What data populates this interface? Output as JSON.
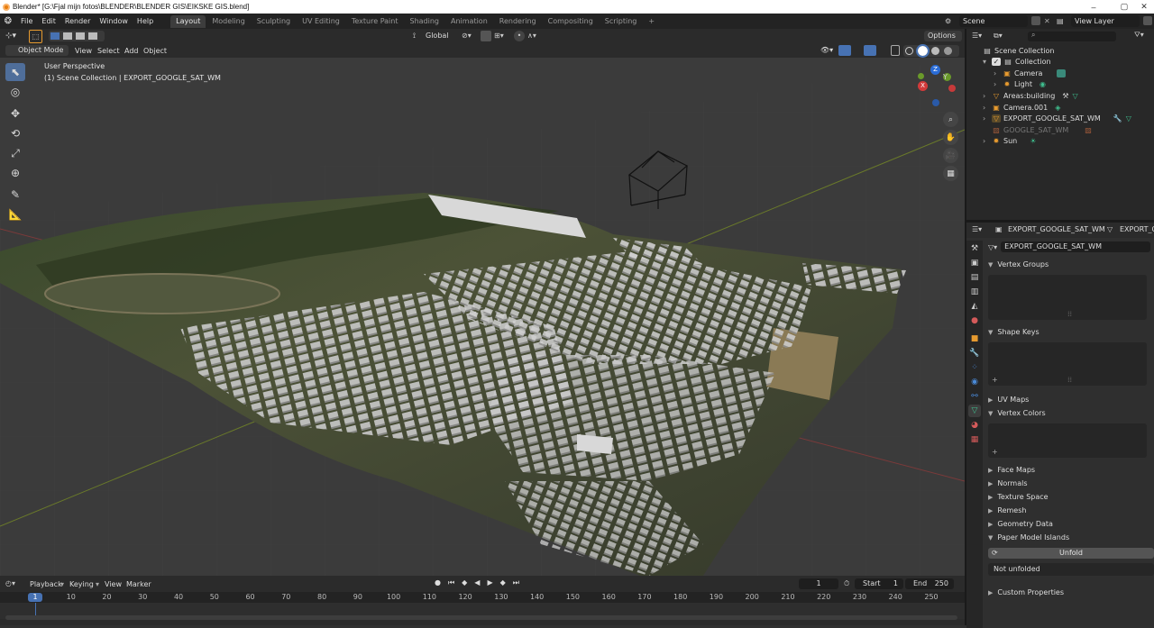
{
  "window": {
    "title": "Blender* [G:\\Fjal mijn fotos\\BLENDER\\BLENDER GIS\\EIKSKE GIS.blend]",
    "controls": [
      "–",
      "▢",
      "✕"
    ]
  },
  "menu": {
    "items": [
      "File",
      "Edit",
      "Render",
      "Window",
      "Help"
    ]
  },
  "workspaces": {
    "tabs": [
      "Layout",
      "Modeling",
      "Sculpting",
      "UV Editing",
      "Texture Paint",
      "Shading",
      "Animation",
      "Rendering",
      "Compositing",
      "Scripting"
    ],
    "active": "Layout",
    "add": "+"
  },
  "scene": {
    "scene_label": "Scene",
    "view_layer_label": "View Layer"
  },
  "viewport": {
    "transform_orientation": "Global",
    "options_label": "Options",
    "mode": "Object Mode",
    "header_menus": [
      "View",
      "Select",
      "Add",
      "Object"
    ],
    "overlay_line1": "User Perspective",
    "overlay_line2": "(1) Scene Collection | EXPORT_GOOGLE_SAT_WM",
    "gizmo_axes": [
      "Z",
      "Y",
      "X"
    ]
  },
  "tools": [
    "select-box-icon",
    "cursor-icon",
    "move-icon",
    "rotate-icon",
    "scale-icon",
    "transform-icon",
    "annotate-icon",
    "measure-icon"
  ],
  "outliner": {
    "search_placeholder": "",
    "rows": [
      {
        "label": "Scene Collection",
        "icon": "collection-icon",
        "dim": false
      },
      {
        "label": "Collection",
        "icon": "collection-icon",
        "dim": false
      },
      {
        "label": "Camera",
        "icon": "camera-icon",
        "dim": false
      },
      {
        "label": "Light",
        "icon": "light-icon",
        "dim": false
      },
      {
        "label": "Areas:building",
        "icon": "mesh-icon",
        "dim": false
      },
      {
        "label": "Camera.001",
        "icon": "camera-icon",
        "dim": false
      },
      {
        "label": "EXPORT_GOOGLE_SAT_WM",
        "icon": "mesh-icon",
        "dim": false
      },
      {
        "label": "GOOGLE_SAT_WM",
        "icon": "image-icon",
        "dim": true
      },
      {
        "label": "Sun",
        "icon": "light-icon",
        "dim": false
      }
    ]
  },
  "properties": {
    "object_name": "EXPORT_GOOGLE_SAT_WM",
    "object_name_2": "EXPORT_GOOGLE_SAT_WM",
    "mesh_name": "EXPORT_GOOGLE_SAT_WM",
    "sections": [
      "Vertex Groups",
      "Shape Keys",
      "UV Maps",
      "Vertex Colors",
      "Face Maps",
      "Normals",
      "Texture Space",
      "Remesh",
      "Geometry Data",
      "Paper Model Islands",
      "Custom Properties"
    ],
    "unfold_label": "Unfold",
    "unfolded_status": "Not unfolded",
    "list_add": "+",
    "list_remove": "-"
  },
  "timeline": {
    "menus": [
      "Playback",
      "Keying",
      "View",
      "Marker"
    ],
    "current_frame": "1",
    "start_label": "Start",
    "start_value": "1",
    "end_label": "End",
    "end_value": "250",
    "ruler": [
      "1",
      "10",
      "20",
      "30",
      "40",
      "50",
      "60",
      "70",
      "80",
      "90",
      "100",
      "110",
      "120",
      "130",
      "140",
      "150",
      "160",
      "170",
      "180",
      "190",
      "200",
      "210",
      "220",
      "230",
      "240",
      "250"
    ]
  },
  "colors": {
    "accent": "#4772b3",
    "selection": "#e69a2f",
    "header": "#2b2b2b",
    "panel": "#303030"
  }
}
